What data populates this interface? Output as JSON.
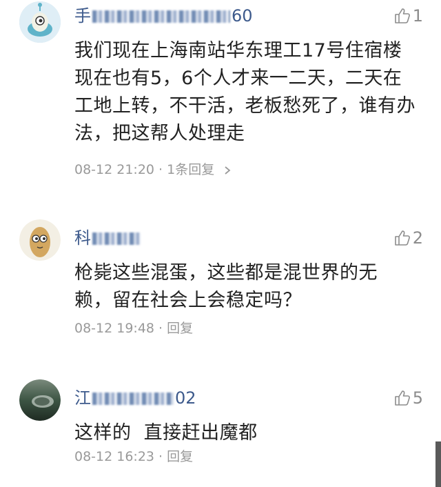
{
  "comments": [
    {
      "username_prefix": "手",
      "username_suffix": "60",
      "likes": "1",
      "text": "我们现在上海南站华东理工17号住宿楼现在也有5，6个人才来一二天，二天在工地上转，不干活，老板愁死了，谁有办法，把这帮人处理走",
      "time": "08-12 21:20",
      "separator": " · ",
      "reply_label": "1条回复",
      "reply_arrow": "〉"
    },
    {
      "username_prefix": "科",
      "username_suffix": "",
      "likes": "2",
      "text": "枪毙这些混蛋，这些都是混世界的无赖，留在社会上会稳定吗？",
      "time": "08-12 19:48",
      "separator": " · ",
      "reply_label": "回复"
    },
    {
      "username_prefix": "江",
      "username_suffix": "02",
      "likes": "5",
      "text": "这样的  直接赶出魔都",
      "time": "08-12 16:23",
      "separator": " · ",
      "reply_label": "回复"
    }
  ],
  "colors": {
    "username": "#3d5a8c",
    "meta": "#999999",
    "body_text": "#222222"
  },
  "icons": [
    "thumbs-up-icon",
    "chevron-right-icon"
  ]
}
